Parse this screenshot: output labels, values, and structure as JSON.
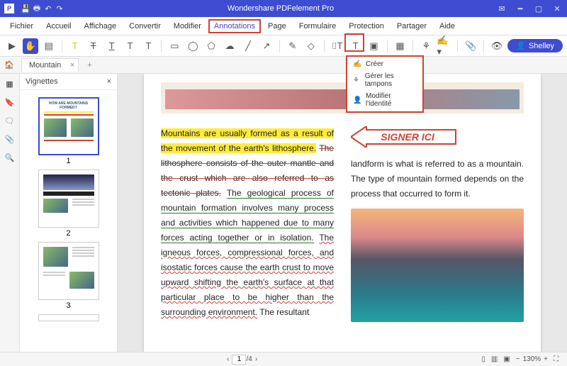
{
  "titlebar": {
    "title": "Wondershare PDFelement Pro"
  },
  "menu": [
    "Fichier",
    "Accueil",
    "Affichage",
    "Convertir",
    "Modifier",
    "Annotations",
    "Page",
    "Formulaire",
    "Protection",
    "Partager",
    "Aide"
  ],
  "menu_active_index": 5,
  "user": "Shelley",
  "tab": {
    "label": "Mountain"
  },
  "thumbs_header": "Vignettes",
  "thumb_numbers": [
    "1",
    "2",
    "3"
  ],
  "dropdown": {
    "items": [
      "Créer",
      "Gérer les tampons",
      "Modifier l'identité"
    ]
  },
  "doc": {
    "text_hl": "Mountains are usually formed as a result of the movement of the earth's lithosphere.",
    "text_strike": "The lithosphere consists of the outer mantle and the crust which are also referred to as tectonic plates.",
    "text_green": "The geological process of mountain formation involves many process and activities which happened due to many forces acting together or in isolation.",
    "text_squig": "The igneous forces, compressional forces, and isostatic forces cause the earth crust to move upward shifting the earth's surface at that particular place to be higher than the surrounding environment.",
    "text_tail": "The resultant",
    "stamp": "SIGNER ICI",
    "right_text": "landform is what is referred to as a mountain. The type of mountain formed depends on the process that occurred to form it."
  },
  "status": {
    "page_field": "1",
    "page_total": "/4",
    "zoom": "130%"
  }
}
